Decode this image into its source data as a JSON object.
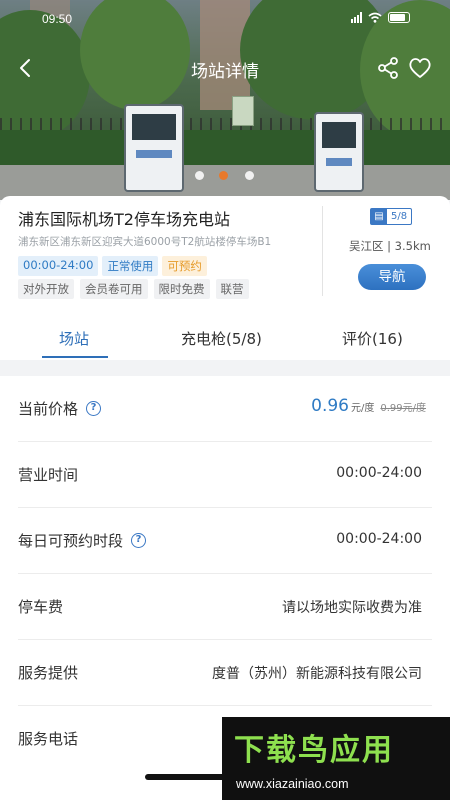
{
  "status_bar": {
    "time": "09:50"
  },
  "header": {
    "title": "场站详情"
  },
  "station": {
    "name": "浦东国际机场T2停车场充电站",
    "address": "浦东新区浦东新区迎宾大道6000号T2航站楼停车场B1",
    "tags_primary": [
      "00:00-24:00",
      "正常使用",
      "可预约"
    ],
    "tags_secondary": [
      "对外开放",
      "会员卷可用",
      "限时免费",
      "联营"
    ],
    "charger_count": "5/8",
    "district": "吴江区 | 3.5km",
    "navigate_label": "导航"
  },
  "tabs": [
    {
      "label": "场站"
    },
    {
      "label": "充电枪(5/8)"
    },
    {
      "label": "评价(16)"
    }
  ],
  "details": {
    "price": {
      "label": "当前价格",
      "value": "0.96",
      "unit": "元/度",
      "original": "0.99元/度"
    },
    "hours": {
      "label": "营业时间",
      "value": "00:00-24:00"
    },
    "reserve": {
      "label": "每日可预约时段",
      "value": "00:00-24:00"
    },
    "parking": {
      "label": "停车费",
      "value": "请以场地实际收费为准"
    },
    "provider": {
      "label": "服务提供",
      "value": "度普（苏州）新能源科技有限公司"
    },
    "phone": {
      "label": "服务电话",
      "value": ""
    }
  },
  "watermark": {
    "title": "下载鸟应用",
    "url": "www.xiazainiao.com"
  },
  "colors": {
    "accent": "#2e6fb8",
    "orange_tag": "#e69a28"
  }
}
